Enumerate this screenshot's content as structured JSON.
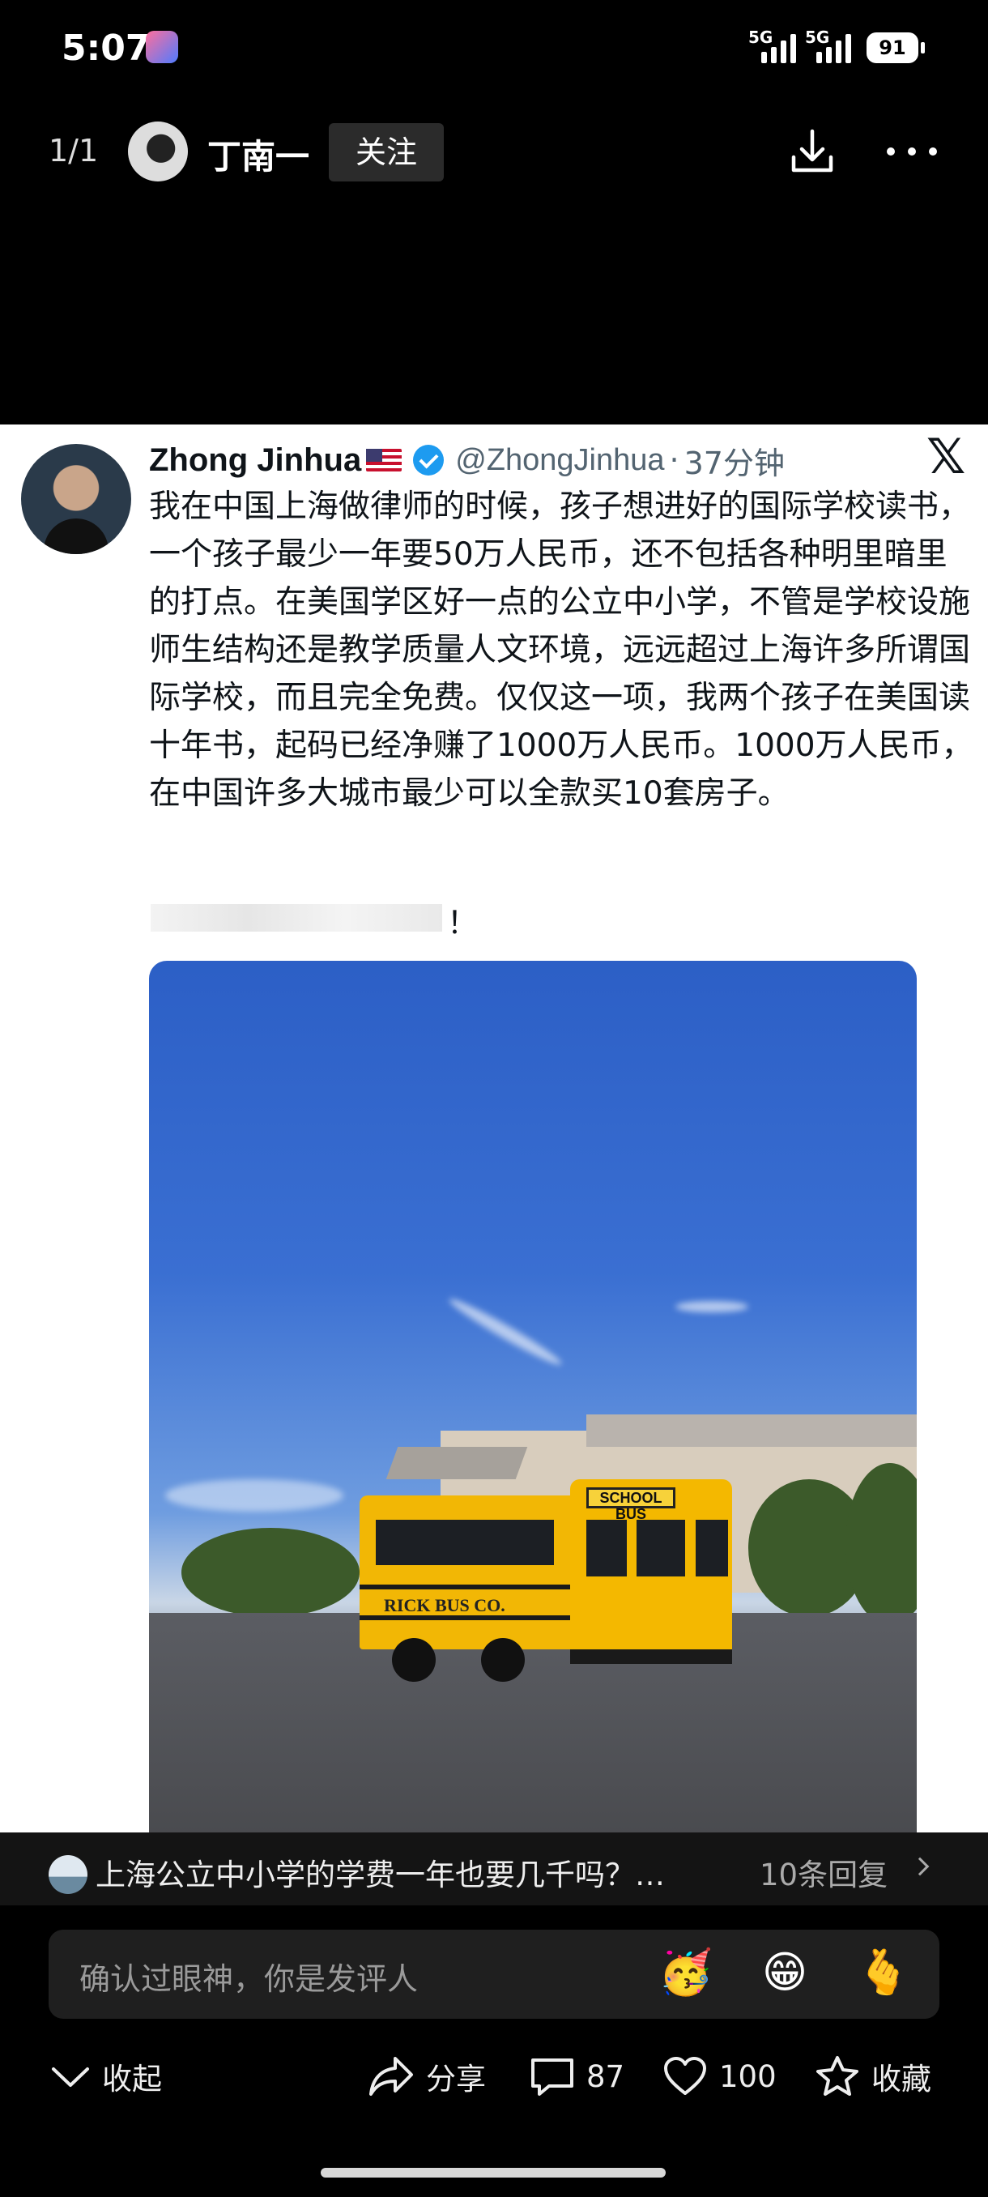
{
  "status_bar": {
    "time": "5:07",
    "signal_1": "5G",
    "signal_2": "5G",
    "battery": "91"
  },
  "top_bar": {
    "pager": "1/1",
    "username": "丁南一",
    "follow_label": "关注",
    "icons": [
      "download-icon",
      "more-icon"
    ]
  },
  "post": {
    "author_name": "Zhong Jinhua",
    "author_handle": "@ZhongJinhua",
    "separator": "·",
    "time_ago": "37分钟",
    "body": "我在中国上海做律师的时候，孩子想进好的国际学校读书，一个孩子最少一年要50万人民币，还不包括各种明里暗里的打点。在美国学区好一点的公立中小学，不管是学校设施师生结构还是教学质量人文环境，远远超过上海许多所谓国际学校，而且完全免费。仅仅这一项，我两个孩子在美国读十年书，起码已经净赚了1000万人民币。1000万人民币，在中国许多大城市最少可以全款买10套房子。",
    "body_tail": "！",
    "photo": {
      "bus_sign": "SCHOOL BUS",
      "bus_side": "RICK BUS CO."
    }
  },
  "reply_preview": {
    "text": "上海公立中小学的学费一年也要几千吗？…",
    "count": "10条回复"
  },
  "comment_input": {
    "placeholder": "确认过眼神，你是发评人",
    "emojis": [
      "🥳",
      "😁",
      "🫰"
    ]
  },
  "actions": {
    "collapse": "收起",
    "share": "分享",
    "comments": "87",
    "likes": "100",
    "favorite": "收藏"
  },
  "colors": {
    "background": "#000000",
    "post_bg": "#ffffff",
    "verified_blue": "#1d9bf0",
    "bus_yellow": "#f2b705"
  }
}
